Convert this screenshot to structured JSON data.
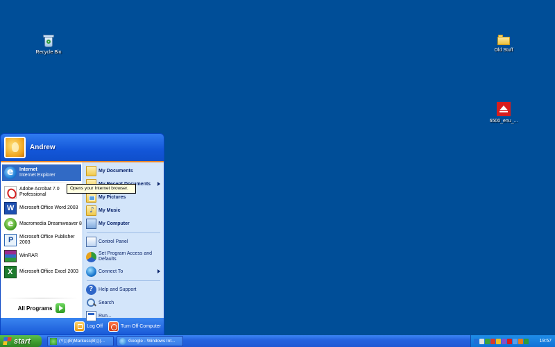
{
  "desktop": {
    "icons": [
      {
        "label": "Recycle Bin",
        "icon": "recycle-bin-icon"
      },
      {
        "label": "Old Stuff",
        "icon": "folder-icon"
      },
      {
        "label": "6500_enu_...",
        "icon": "adobe-installer-icon"
      }
    ]
  },
  "start_menu": {
    "user": "Andrew",
    "pinned": [
      {
        "title": "Internet",
        "subtitle": "Internet Explorer",
        "icon": "internet-explorer-icon"
      }
    ],
    "recent": [
      {
        "label": "Adobe Acrobat 7.0 Professional",
        "line1": "Adobe Acrobat 7.0",
        "line2": "Professional",
        "icon": "acrobat-icon"
      },
      {
        "label": "Microsoft Office Word 2003",
        "icon": "word-icon"
      },
      {
        "label": "Macromedia Dreamweaver 8",
        "icon": "dreamweaver-icon"
      },
      {
        "label": "Microsoft Office Publisher 2003",
        "line1": "Microsoft Office Publisher",
        "line2": "2003",
        "icon": "publisher-icon"
      },
      {
        "label": "WinRAR",
        "icon": "winrar-icon"
      },
      {
        "label": "Microsoft Office Excel 2003",
        "icon": "excel-icon"
      }
    ],
    "all_programs": "All Programs",
    "places": [
      {
        "label": "My Documents",
        "icon": "folder-icon"
      },
      {
        "label": "My Recent Documents",
        "icon": "folder-icon"
      },
      {
        "label": "My Pictures",
        "icon": "folder-icon"
      },
      {
        "label": "My Music",
        "icon": "music-folder-icon"
      },
      {
        "label": "My Computer",
        "icon": "computer-icon"
      }
    ],
    "system": [
      {
        "label": "Control Panel",
        "icon": "control-panel-icon"
      },
      {
        "label": "Set Program Access and Defaults",
        "line1": "Set Program Access and",
        "line2": "Defaults",
        "icon": "program-access-icon"
      },
      {
        "label": "Connect To",
        "icon": "globe-icon"
      }
    ],
    "tools": [
      {
        "label": "Help and Support",
        "icon": "help-icon"
      },
      {
        "label": "Search",
        "icon": "search-icon"
      },
      {
        "label": "Run...",
        "icon": "run-icon"
      }
    ],
    "log_off": "Log Off",
    "turn_off": "Turn Off Computer"
  },
  "tooltip": "Opens your Internet browser.",
  "taskbar": {
    "start_label": "start",
    "tasks": [
      {
        "label": "(Y);)(B)Markuss(B);)(...",
        "icon": "messenger-icon"
      },
      {
        "label": "Google - Windows Int...",
        "icon": "internet-explorer-icon"
      }
    ],
    "clock": "19:57"
  },
  "colors": {
    "desktop": "#004e98",
    "taskbar": "#245edb",
    "start_button": "#3d9a2e",
    "highlight": "#316ac5",
    "right_pane": "#d3e5fa"
  }
}
